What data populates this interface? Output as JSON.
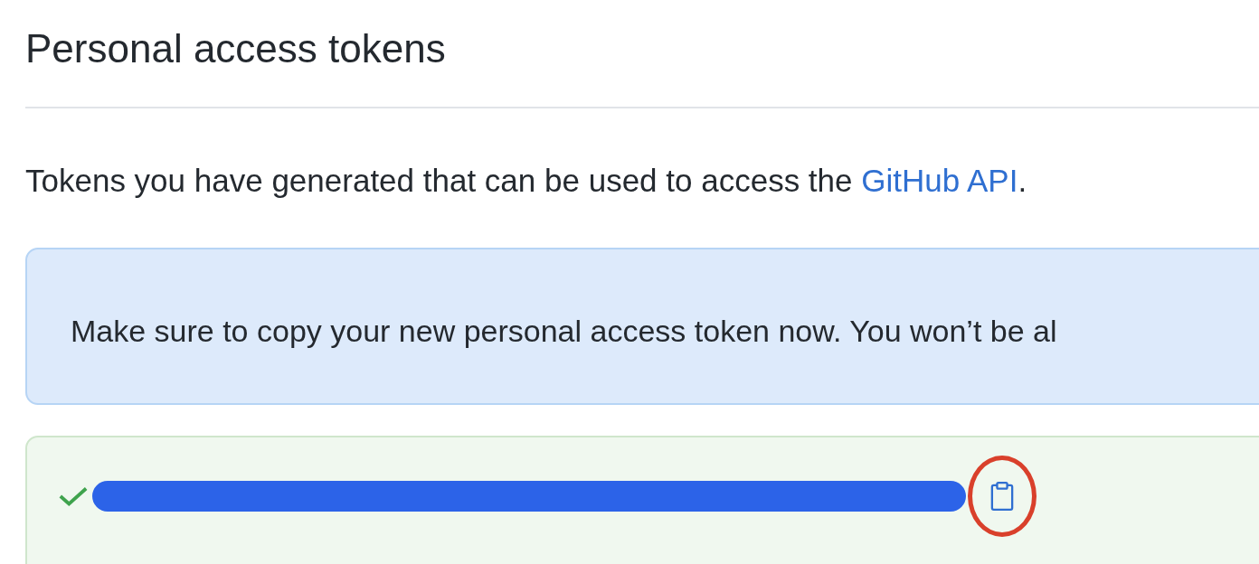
{
  "page": {
    "title": "Personal access tokens"
  },
  "intro": {
    "text": "Tokens you have generated that can be used to access the ",
    "link": "GitHub API",
    "suffix": "."
  },
  "notice": {
    "text": "Make sure to copy your new personal access token now. You won’t be al"
  },
  "new_token": {
    "verified": true,
    "redacted": true,
    "copy_highlighted": true
  }
}
